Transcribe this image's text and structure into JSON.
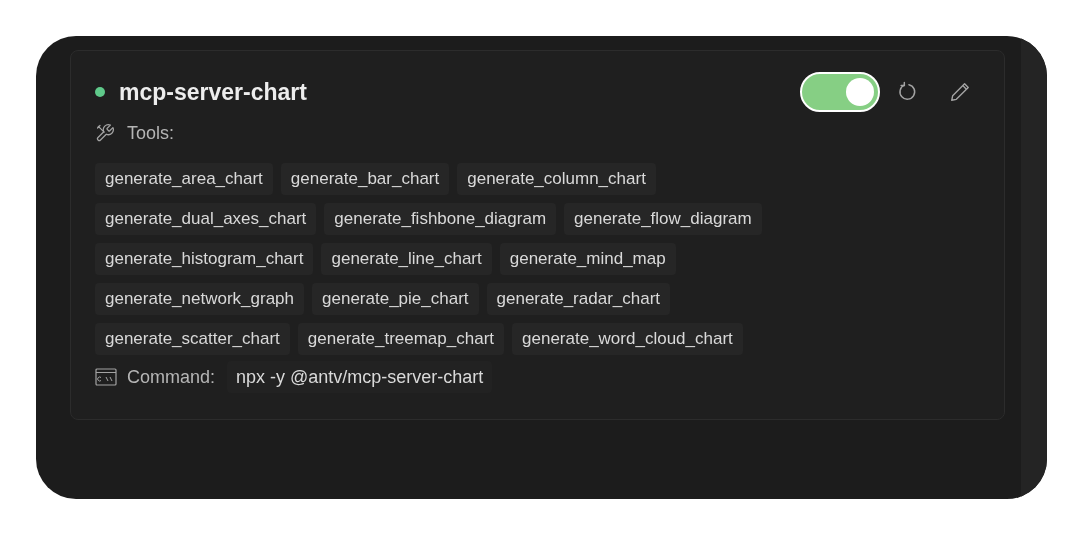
{
  "server": {
    "name": "mcp-server-chart",
    "online": true,
    "enabled": true
  },
  "tools_label": "Tools:",
  "tool_rows": [
    [
      "generate_area_chart",
      "generate_bar_chart",
      "generate_column_chart"
    ],
    [
      "generate_dual_axes_chart",
      "generate_fishbone_diagram",
      "generate_flow_diagram"
    ],
    [
      "generate_histogram_chart",
      "generate_line_chart",
      "generate_mind_map"
    ],
    [
      "generate_network_graph",
      "generate_pie_chart",
      "generate_radar_chart"
    ],
    [
      "generate_scatter_chart",
      "generate_treemap_chart",
      "generate_word_cloud_chart"
    ]
  ],
  "command": {
    "label": "Command:",
    "value": "npx -y @antv/mcp-server-chart"
  }
}
